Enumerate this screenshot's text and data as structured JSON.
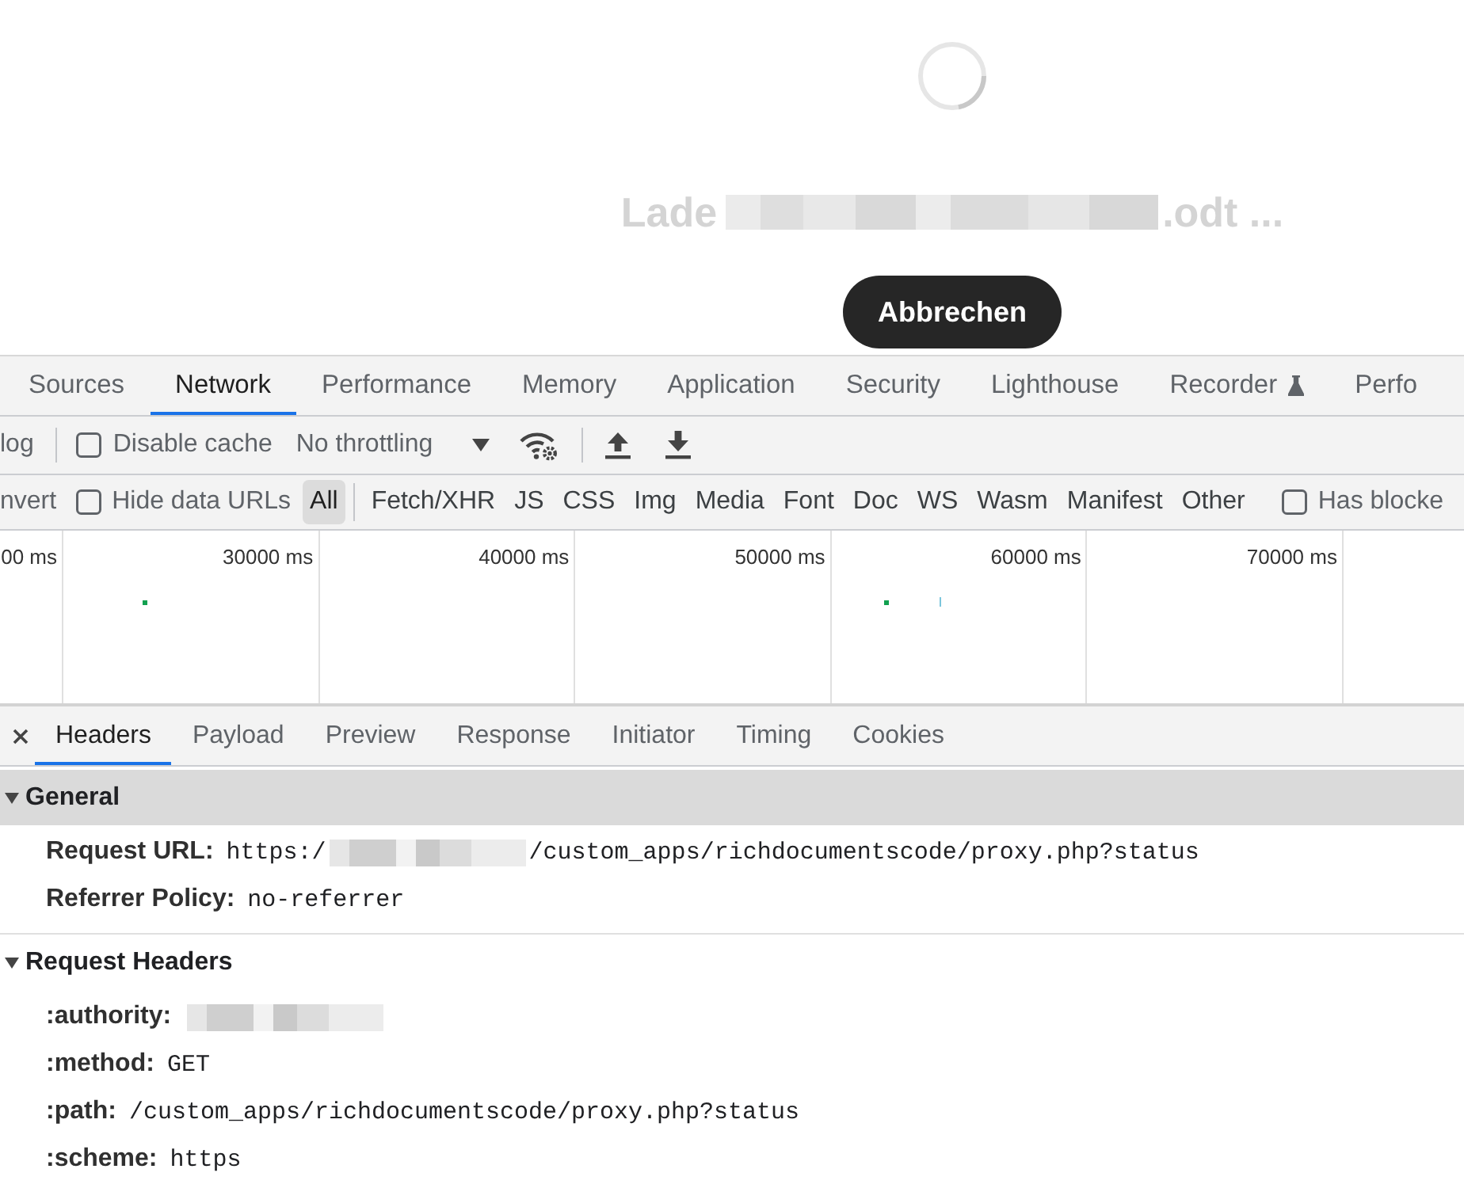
{
  "loading": {
    "title": [
      {
        "kind": "text",
        "text": "Lade"
      },
      {
        "kind": "redacted"
      },
      {
        "kind": "text",
        "text": ".odt ..."
      }
    ],
    "cancel_button": "Abbrechen"
  },
  "devtools": {
    "tabs": [
      {
        "label": "Sources",
        "selected": false,
        "experimental": false
      },
      {
        "label": "Network",
        "selected": true,
        "experimental": false
      },
      {
        "label": "Performance",
        "selected": false,
        "experimental": false
      },
      {
        "label": "Memory",
        "selected": false,
        "experimental": false
      },
      {
        "label": "Application",
        "selected": false,
        "experimental": false
      },
      {
        "label": "Security",
        "selected": false,
        "experimental": false
      },
      {
        "label": "Lighthouse",
        "selected": false,
        "experimental": false
      },
      {
        "label": "Recorder",
        "selected": false,
        "experimental": true
      },
      {
        "label": "Perfo",
        "selected": false,
        "experimental": false
      }
    ],
    "toolbar": {
      "cut_label": "log",
      "disable_cache": {
        "label": "Disable cache",
        "checked": false
      },
      "throttling": "No throttling"
    },
    "filter_bar": {
      "cut_label": "nvert",
      "hide_data_urls": {
        "label": "Hide data URLs",
        "checked": false
      },
      "types": [
        {
          "label": "All",
          "selected": true
        },
        {
          "label": "Fetch/XHR",
          "selected": false
        },
        {
          "label": "JS",
          "selected": false
        },
        {
          "label": "CSS",
          "selected": false
        },
        {
          "label": "Img",
          "selected": false
        },
        {
          "label": "Media",
          "selected": false
        },
        {
          "label": "Font",
          "selected": false
        },
        {
          "label": "Doc",
          "selected": false
        },
        {
          "label": "WS",
          "selected": false
        },
        {
          "label": "Wasm",
          "selected": false
        },
        {
          "label": "Manifest",
          "selected": false
        },
        {
          "label": "Other",
          "selected": false
        }
      ],
      "has_blocked": {
        "label": "Has blocke",
        "checked": false
      }
    },
    "overview": {
      "ticks": [
        "00 ms",
        "30000 ms",
        "40000 ms",
        "50000 ms",
        "60000 ms",
        "70000 ms"
      ]
    },
    "details": {
      "tabs": [
        {
          "label": "Headers",
          "selected": true
        },
        {
          "label": "Payload",
          "selected": false
        },
        {
          "label": "Preview",
          "selected": false
        },
        {
          "label": "Response",
          "selected": false
        },
        {
          "label": "Initiator",
          "selected": false
        },
        {
          "label": "Timing",
          "selected": false
        },
        {
          "label": "Cookies",
          "selected": false
        }
      ],
      "sections": [
        {
          "title": "General",
          "expanded": true,
          "focused": true,
          "rows": [
            {
              "name": "Request URL:",
              "value": [
                {
                  "kind": "text",
                  "text": "https:/"
                },
                {
                  "kind": "redacted"
                },
                {
                  "kind": "text",
                  "text": "/custom_apps/richdocumentscode/proxy.php?status"
                }
              ]
            },
            {
              "name": "Referrer Policy:",
              "value": [
                {
                  "kind": "text",
                  "text": "no-referrer"
                }
              ]
            }
          ]
        },
        {
          "title": "Request Headers",
          "expanded": true,
          "focused": false,
          "rows": [
            {
              "name": ":authority:",
              "value": [
                {
                  "kind": "redacted"
                }
              ]
            },
            {
              "name": ":method:",
              "value": [
                {
                  "kind": "text",
                  "text": "GET"
                }
              ]
            },
            {
              "name": ":path:",
              "value": [
                {
                  "kind": "text",
                  "text": "/custom_apps/richdocumentscode/proxy.php?status"
                }
              ]
            },
            {
              "name": ":scheme:",
              "value": [
                {
                  "kind": "text",
                  "text": "https"
                }
              ]
            }
          ]
        }
      ]
    }
  }
}
